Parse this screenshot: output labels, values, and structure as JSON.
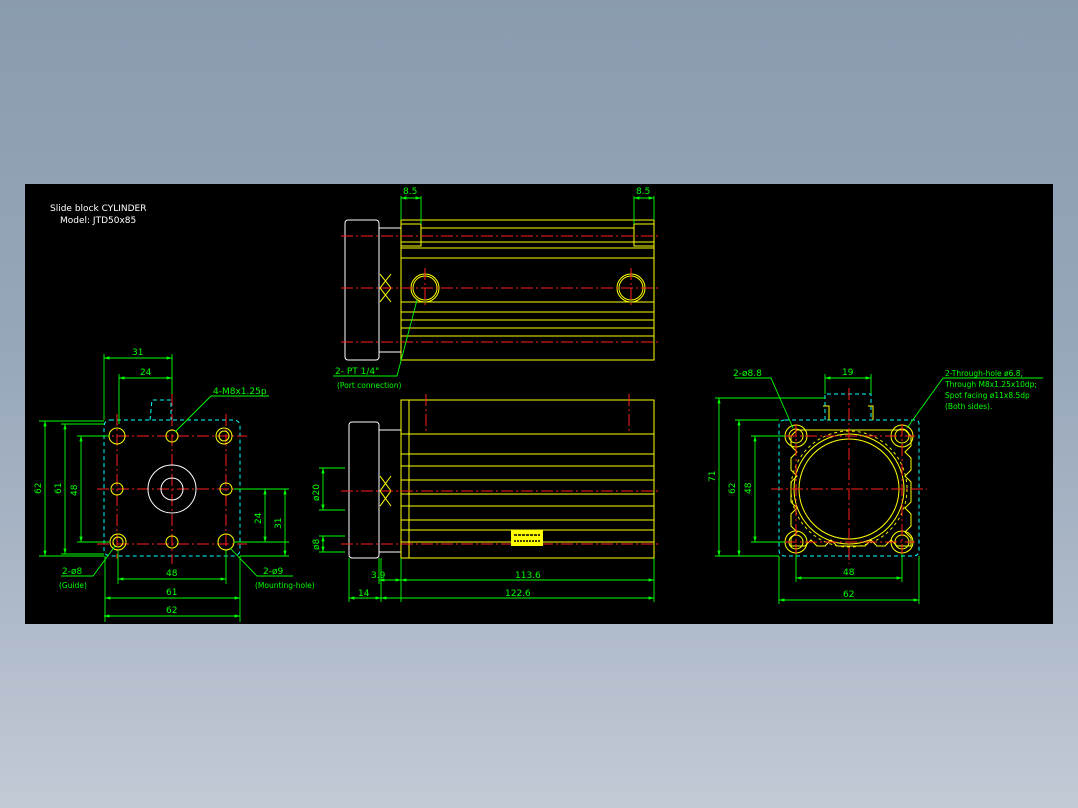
{
  "title": {
    "line1": "Slide block CYLINDER",
    "line2": "Model: JTD50x85"
  },
  "colors": {
    "background_top": "#8a9bb0",
    "background_bottom": "#c2cad6",
    "canvas": "#000000",
    "outline": "#ffff00",
    "dimension": "#00ff00",
    "hidden_line": "#00ffff",
    "center_line": "#ff2020",
    "text": "#ffffff"
  },
  "left_view": {
    "dims": {
      "top_31": "31",
      "top_24": "24",
      "left_62": "62",
      "left_61": "61",
      "left_48": "48",
      "right_24": "24",
      "right_31": "31",
      "bottom_48": "48",
      "bottom_61": "61",
      "bottom_62": "62"
    },
    "callouts": {
      "thread": "4-M8x1.25p",
      "guide_hole": "2-ø8",
      "guide_note": "(Guide)",
      "mount_hole": "2-ø9",
      "mount_note": "(Mounting-hole)"
    }
  },
  "top_view": {
    "dims": {
      "left_8_5": "8.5",
      "right_8_5": "8.5"
    },
    "callouts": {
      "port": "2- PT 1/4\"",
      "port_note": "(Port connection)"
    }
  },
  "side_view": {
    "dims": {
      "dia_20": "ø20",
      "dia_8": "ø8",
      "d_3_9": "3.9",
      "d_113_6": "113.6",
      "d_14": "14",
      "d_122_6": "122.6"
    }
  },
  "right_view": {
    "dims": {
      "top_19": "19",
      "left_71": "71",
      "left_62": "62",
      "left_48": "48",
      "bottom_48": "48",
      "bottom_62": "62"
    },
    "callouts": {
      "bore": "2-ø8.8",
      "through_1": "2-Through-hole ø6.8,",
      "through_2": "Through M8x1.25x10dp;",
      "through_3": "Spot facing ø11x8.5dp",
      "through_4": "(Both sides)."
    }
  }
}
